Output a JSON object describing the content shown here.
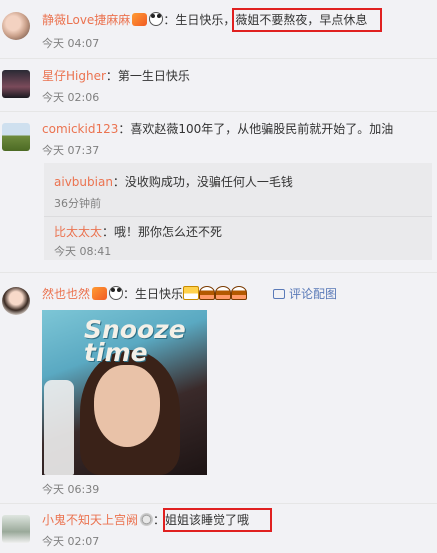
{
  "comments": [
    {
      "user": "静薇Love捷麻麻",
      "text": "：生日快乐，",
      "highlight": "薇姐不要熬夜，早点休息",
      "time": "今天 04:07"
    },
    {
      "user": "星仔Higher",
      "text": "：第一生日快乐",
      "time": "今天 02:06"
    },
    {
      "user": "comickid123",
      "text": "：喜欢赵薇100年了，从他骗股民前就开始了。加油",
      "time": "今天 07:37",
      "replies": [
        {
          "user": "aivbubian",
          "text": "：没收购成功，没骗任何人一毛钱",
          "time": "36分钟前"
        },
        {
          "user": "比太太太",
          "text": "：哦！那你怎么还不死",
          "time": "今天 08:41"
        }
      ]
    },
    {
      "user": "然也也然",
      "text": "：生日快乐",
      "album_link": "评论配图",
      "photo_text": "Snooze time",
      "time": "今天 06:39"
    },
    {
      "user": "小鬼不知天上宫阙",
      "text": "：",
      "highlight": "姐姐该睡觉了哦",
      "time": "今天 02:07"
    }
  ],
  "icons": {
    "vip_badge": "vip-badge-icon",
    "panda_badge": "panda-badge-icon",
    "medal_badge": "medal-badge-icon",
    "beer_emoji": "beer-emoji-icon",
    "cake_emoji": "cake-emoji-icon",
    "album_icon": "image-icon"
  },
  "colors": {
    "username": "#eb7350",
    "highlight_border": "#e02020",
    "link": "#5a7ab8"
  }
}
